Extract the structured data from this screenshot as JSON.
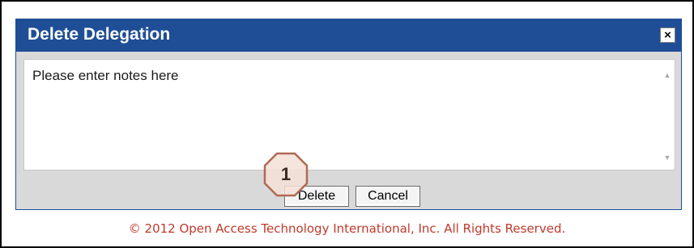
{
  "dialog": {
    "title": "Delete Delegation",
    "close_label": "×",
    "notes_value": "Please enter notes here",
    "buttons": {
      "delete_label": "Delete",
      "cancel_label": "Cancel"
    }
  },
  "annotation": {
    "step_number": "1"
  },
  "footer": {
    "copyright": "© 2012 Open Access Technology International, Inc. All Rights Reserved."
  },
  "colors": {
    "titlebar": "#1f4e96",
    "title_text": "#ffffff",
    "dialog_body": "#d9d9d9",
    "copyright_text": "#c0392b",
    "callout_fill": "#f3e1d6",
    "callout_stroke": "#b06a54"
  },
  "icons": {
    "close": "close-icon",
    "scroll_up": "scroll-up-arrow-icon",
    "scroll_down": "scroll-down-arrow-icon"
  }
}
